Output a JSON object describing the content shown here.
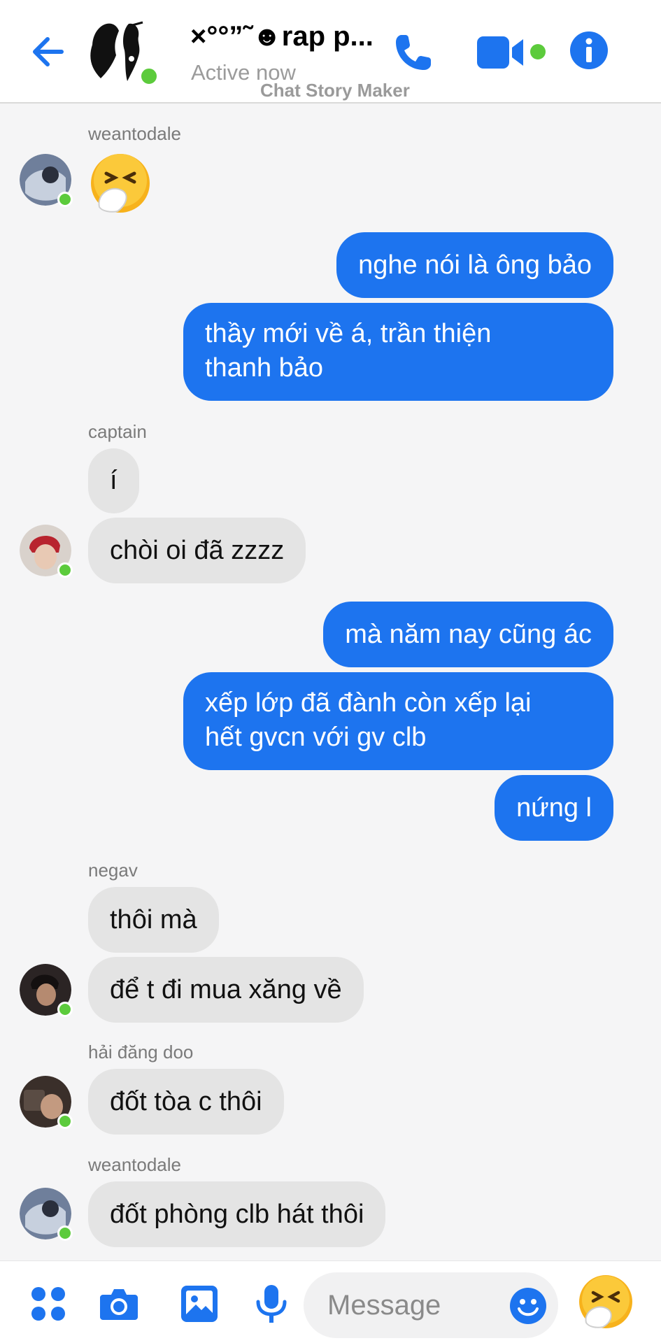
{
  "header": {
    "title": "×°°”˜☻rap p...",
    "status": "Active now",
    "watermark": "Chat Story Maker",
    "icons": [
      "back-arrow-icon",
      "phone-icon",
      "video-camera-icon",
      "info-icon"
    ]
  },
  "messages": [
    {
      "sender": "weantodale",
      "emoji": "sneezing-face"
    },
    {
      "outgoing": "nghe nói là ông bảo"
    },
    {
      "outgoing": "thầy mới về á, trần thiện thanh bảo"
    },
    {
      "sender": "captain",
      "texts": [
        "í",
        "chòi oi đã zzzz"
      ]
    },
    {
      "outgoing": "mà năm nay cũng ác"
    },
    {
      "outgoing": "xếp lớp đã đành còn xếp lại hết gvcn với gv clb"
    },
    {
      "outgoing": "nứng l"
    },
    {
      "sender": "negav",
      "texts": [
        "thôi mà",
        "để t đi mua xăng về"
      ]
    },
    {
      "sender": "hải đăng doo",
      "texts": [
        "đốt tòa c thôi"
      ]
    },
    {
      "sender": "weantodale",
      "texts": [
        "đốt phòng clb hát thôi"
      ]
    }
  ],
  "m": {
    "s1": "weantodale",
    "o1": "nghe nói là ông bảo",
    "o2a": "thầy mới về á, trần thiện",
    "o2b": "thanh bảo",
    "s2": "captain",
    "i1": "í",
    "i2": "chòi oi đã zzzz",
    "o3": "mà năm nay cũng ác",
    "o4a": "xếp lớp đã đành còn xếp lại",
    "o4b": "hết gvcn với gv clb",
    "o5": "nứng l",
    "s3": "negav",
    "i3": "thôi mà",
    "i4": "để t đi mua xăng về",
    "s4": "hải đăng doo",
    "i5": "đốt tòa c thôi",
    "s5": "weantodale",
    "i6": "đốt phòng clb hát thôi"
  },
  "composer": {
    "placeholder": "Message",
    "icons": [
      "apps-icon",
      "camera-icon",
      "photo-icon",
      "microphone-icon",
      "smile-icon",
      "sneezing-emoji-icon"
    ]
  },
  "colors": {
    "accent": "#1d74ef",
    "incoming_bubble": "#e4e4e4",
    "online": "#5ccb3c",
    "background": "#f5f5f6"
  }
}
